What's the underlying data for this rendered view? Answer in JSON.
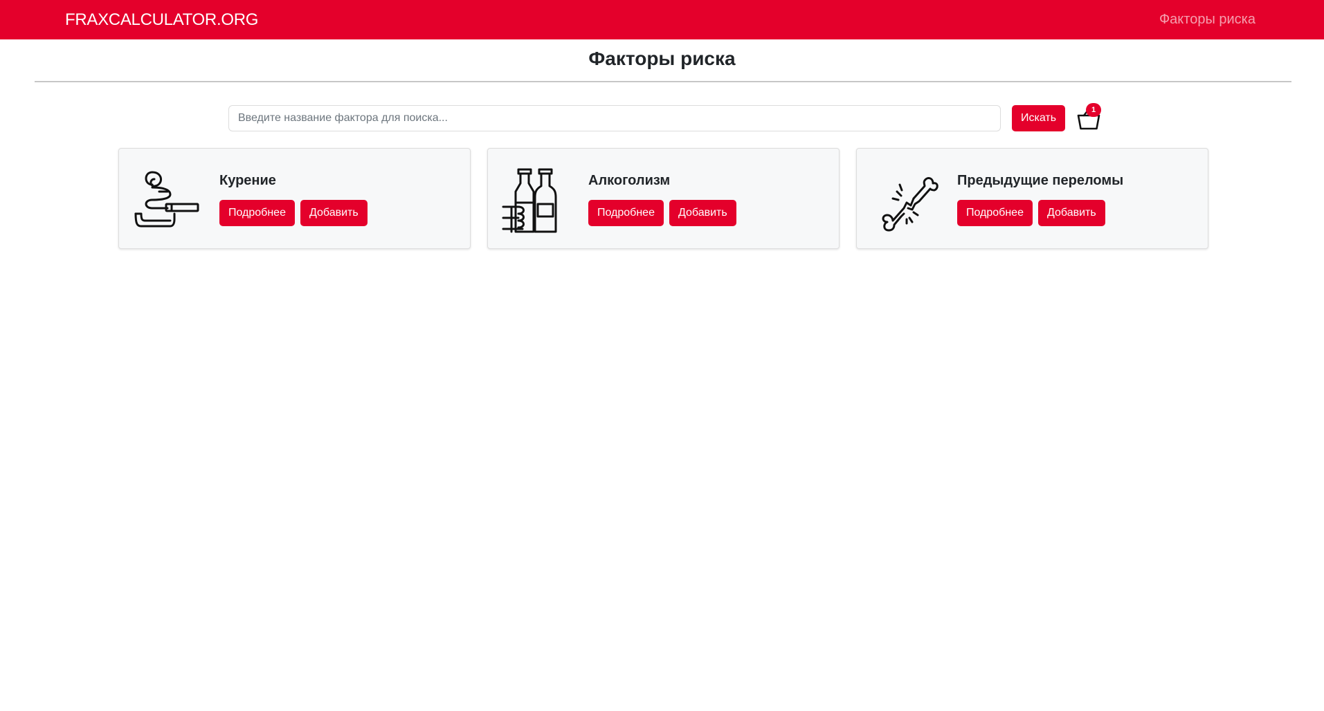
{
  "header": {
    "brand": "FRAXCALCULATOR.ORG",
    "nav_link": "Факторы риска"
  },
  "page": {
    "title": "Факторы риска"
  },
  "search": {
    "placeholder": "Введите название фактора для поиска...",
    "value": "",
    "button_label": "Искать"
  },
  "basket": {
    "icon": "basket-icon",
    "count": "1"
  },
  "factors": [
    {
      "name": "Курение",
      "icon": "smoking-icon",
      "details_label": "Подробнее",
      "add_label": "Добавить"
    },
    {
      "name": "Алкоголизм",
      "icon": "alcohol-bottles-icon",
      "details_label": "Подробнее",
      "add_label": "Добавить"
    },
    {
      "name": "Предыдущие переломы",
      "icon": "broken-bone-icon",
      "details_label": "Подробнее",
      "add_label": "Добавить"
    }
  ],
  "colors": {
    "brand": "#e4002b",
    "card_background": "#f7f8f9",
    "text": "#212529"
  }
}
